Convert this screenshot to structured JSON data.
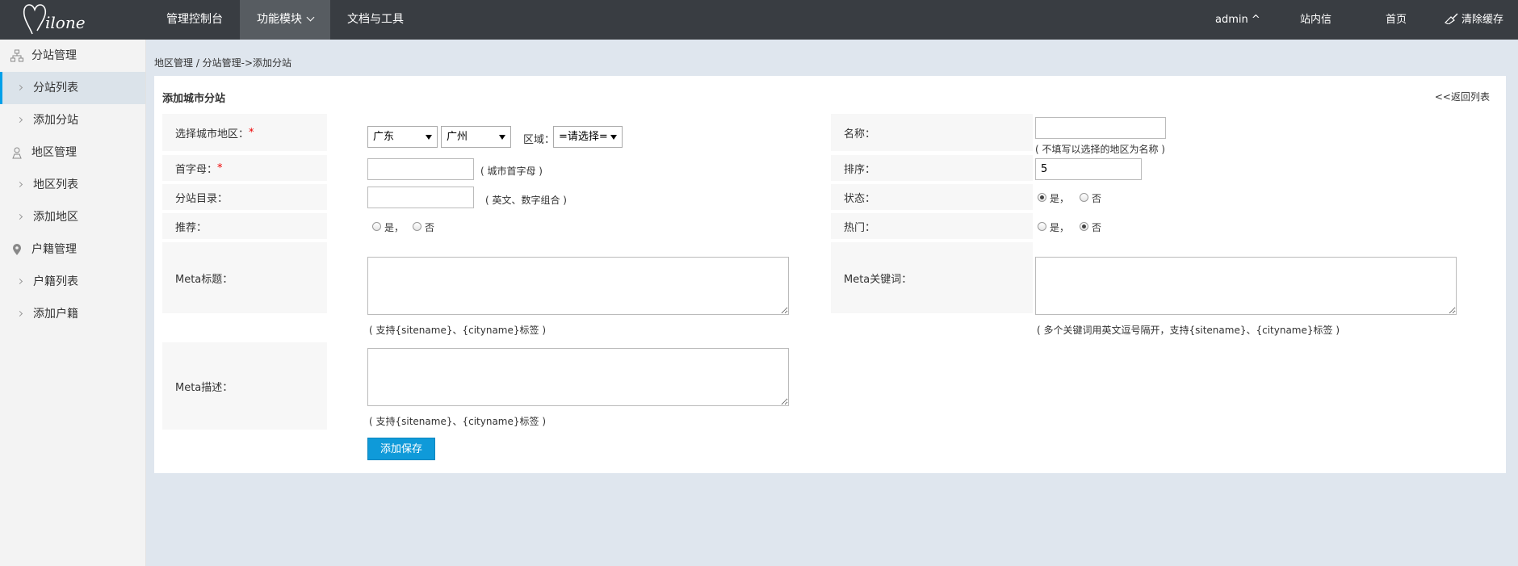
{
  "header": {
    "logo_text": "Milone",
    "nav": [
      {
        "label": "管理控制台"
      },
      {
        "label": "功能模块"
      },
      {
        "label": "文档与工具"
      }
    ],
    "user": "admin ^",
    "messages": "站内信",
    "home": "首页",
    "clear_cache": "清除缓存"
  },
  "sidebar": {
    "groups": [
      {
        "label": "分站管理",
        "icon": "sitemap-icon",
        "items": [
          {
            "label": "分站列表"
          },
          {
            "label": "添加分站"
          }
        ]
      },
      {
        "label": "地区管理",
        "icon": "map-user-icon",
        "items": [
          {
            "label": "地区列表"
          },
          {
            "label": "添加地区"
          }
        ]
      },
      {
        "label": "户籍管理",
        "icon": "location-pin-icon",
        "items": [
          {
            "label": "户籍列表"
          },
          {
            "label": "添加户籍"
          }
        ]
      }
    ]
  },
  "breadcrumb": "地区管理 / 分站管理->添加分站",
  "panel": {
    "title": "添加城市分站",
    "back": "<<返回列表"
  },
  "form": {
    "city_label": "选择城市地区：",
    "required_mark": "*",
    "province": "广东",
    "city": "广州",
    "district_label": "区域：",
    "district": "=请选择=",
    "name_label": "名称：",
    "name_value": "",
    "name_hint": "( 不填写以选择的地区为名称 )",
    "initial_label": "首字母：",
    "initial_value": "",
    "initial_hint": "( 城市首字母 )",
    "order_label": "排序：",
    "order_value": "5",
    "dir_label": "分站目录：",
    "dir_value": "",
    "dir_hint": "( 英文、数字组合 )",
    "status_label": "状态：",
    "status_yes": "是，",
    "status_no": "否",
    "status_selected": "是",
    "recommend_label": "推荐：",
    "recommend_yes": "是，",
    "recommend_no": "否",
    "recommend_selected": "none",
    "hot_label": "热门：",
    "hot_yes": "是，",
    "hot_no": "否",
    "hot_selected": "否",
    "meta_title_label": "Meta标题：",
    "meta_title_value": "",
    "meta_title_hint": "( 支持{sitename}、{cityname}标签 )",
    "meta_keywords_label": "Meta关键词：",
    "meta_keywords_value": "",
    "meta_keywords_hint": "( 多个关键词用英文逗号隔开，支持{sitename}、{cityname}标签 )",
    "meta_desc_label": "Meta描述：",
    "meta_desc_value": "",
    "meta_desc_hint": "( 支持{sitename}、{cityname}标签 )",
    "save_button": "添加保存"
  },
  "colors": {
    "topbar": "#393d42",
    "nav_active": "#575c61",
    "sidebar": "#f3f3f3",
    "accent": "#00a0e9",
    "button": "#0f9ad9",
    "page_bg": "#dfe6ee"
  }
}
